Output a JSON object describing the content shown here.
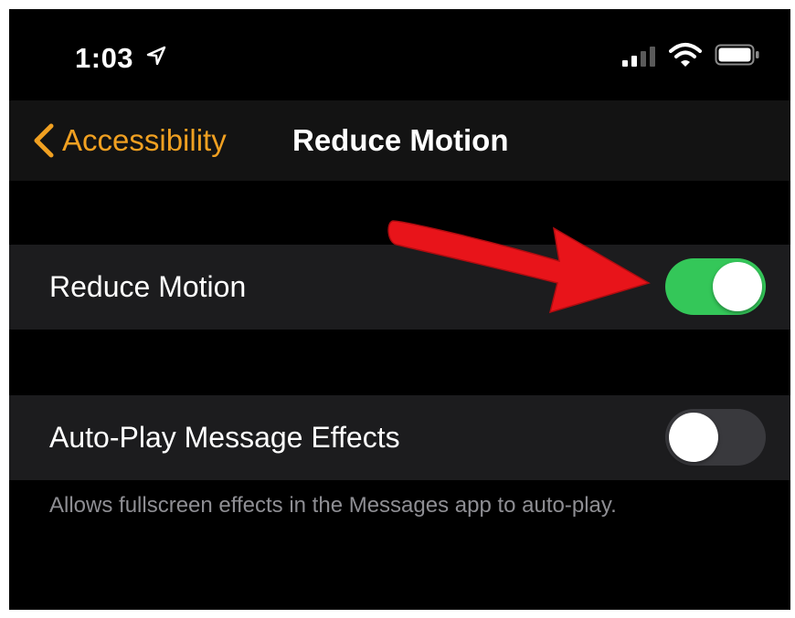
{
  "status_bar": {
    "time": "1:03",
    "icons": [
      "location-arrow-icon",
      "cellular-signal-icon",
      "wifi-icon",
      "battery-icon"
    ]
  },
  "nav": {
    "back_label": "Accessibility",
    "title": "Reduce Motion"
  },
  "settings": [
    {
      "label": "Reduce Motion",
      "enabled": true
    },
    {
      "label": "Auto-Play Message Effects",
      "enabled": false
    }
  ],
  "footer": "Allows fullscreen effects in the Messages app to auto-play.",
  "colors": {
    "accent": "#f0a021",
    "toggle_on": "#34c759",
    "toggle_off": "#39393d",
    "annotation_arrow": "#e8141a"
  }
}
